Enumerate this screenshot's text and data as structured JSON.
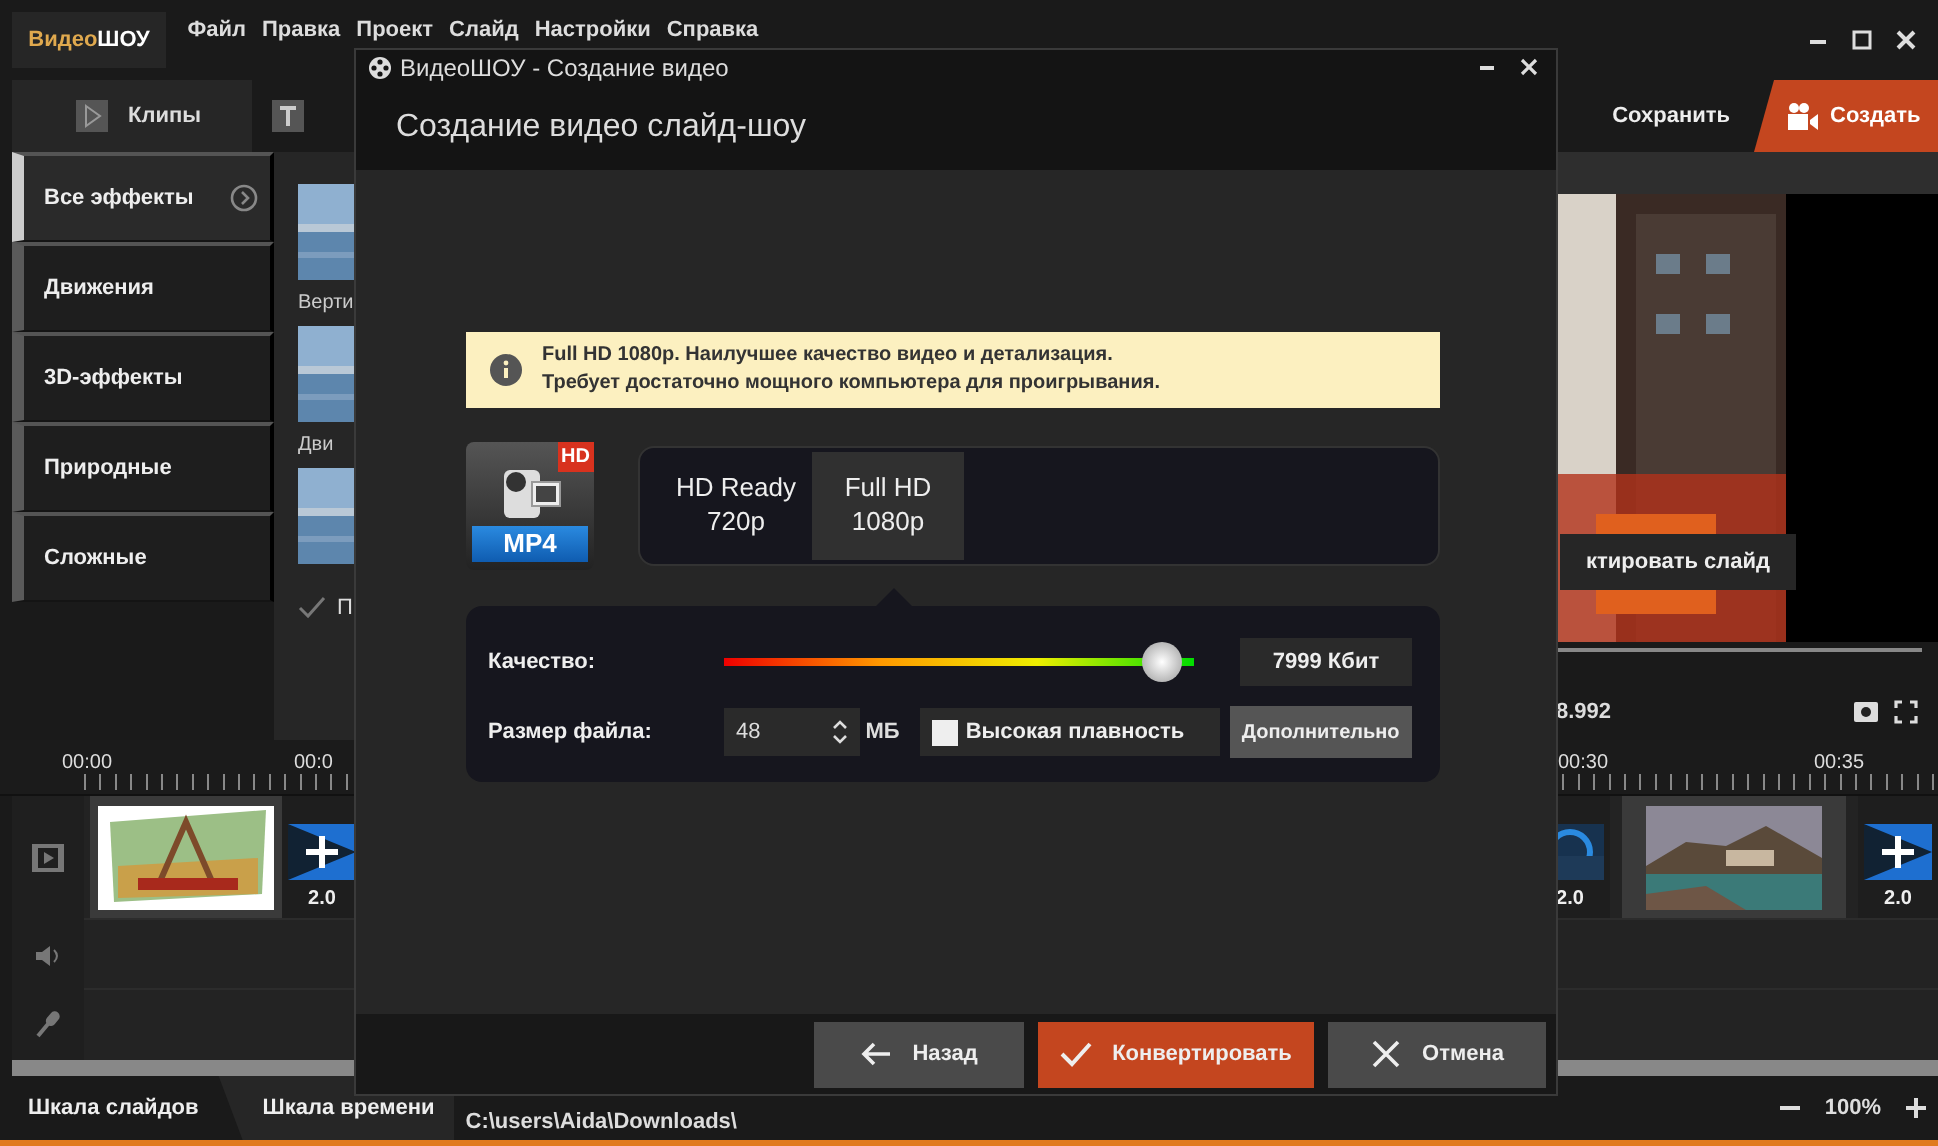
{
  "app": {
    "logo": [
      "Видео",
      "ШОУ"
    ],
    "menu": [
      "Файл",
      "Правка",
      "Проект",
      "Слайд",
      "Настройки",
      "Справка"
    ]
  },
  "toolbar": {
    "tabs": [
      {
        "label": "Клипы",
        "selected": true
      }
    ],
    "save": "Сохранить",
    "create": "Создать"
  },
  "sidebar": {
    "items": [
      {
        "label": "Все эффекты",
        "selected": true
      },
      {
        "label": "Движения",
        "selected": false
      },
      {
        "label": "3D-эффекты",
        "selected": false
      },
      {
        "label": "Природные",
        "selected": false
      },
      {
        "label": "Сложные",
        "selected": false
      }
    ]
  },
  "effects": {
    "captions": [
      "Верти",
      "Дви"
    ],
    "apply": "П"
  },
  "preview": {
    "edit_button": "ктировать слайд",
    "time": "8.992"
  },
  "timeline": {
    "ticks": [
      "00:00",
      "00:0",
      "00:30",
      "00:35"
    ],
    "start": [
      {
        "kind": "slide"
      },
      {
        "kind": "transition",
        "duration": "2.0"
      }
    ],
    "end": [
      {
        "kind": "transition",
        "duration": "2.0"
      },
      {
        "kind": "slide"
      },
      {
        "kind": "transition",
        "duration": "2.0"
      }
    ]
  },
  "bottom": {
    "tabs": [
      {
        "label": "Шкала слайдов",
        "selected": true
      },
      {
        "label": "Шкала времени",
        "selected": false
      }
    ],
    "path": "C:\\users\\Aida\\Downloads\\",
    "zoom": "100%"
  },
  "dialog": {
    "title": "ВидеоШОУ - Создание видео",
    "heading": "Создание видео слайд-шоу",
    "info": [
      "Full HD 1080p. Наилучшее качество видео и детализация.",
      "Требует достаточно мощного компьютера для проигрывания."
    ],
    "format": {
      "badge": "HD",
      "label": "MP4"
    },
    "resolutions": [
      {
        "name": "HD Ready",
        "value": "720p",
        "selected": false
      },
      {
        "name": "Full HD",
        "value": "1080p",
        "selected": true
      }
    ],
    "quality": {
      "label": "Качество:",
      "level": 0.93,
      "reading": "7999 Кбит"
    },
    "file_size": {
      "label": "Размер файла:",
      "value": "48",
      "unit": "МБ"
    },
    "smooth": {
      "label": "Высокая плавность",
      "checked": false
    },
    "advanced": "Дополнительно",
    "buttons": [
      {
        "kind": "back",
        "label": "Назад"
      },
      {
        "kind": "convert",
        "label": "Конвертировать"
      },
      {
        "kind": "cancel",
        "label": "Отмена"
      }
    ]
  }
}
